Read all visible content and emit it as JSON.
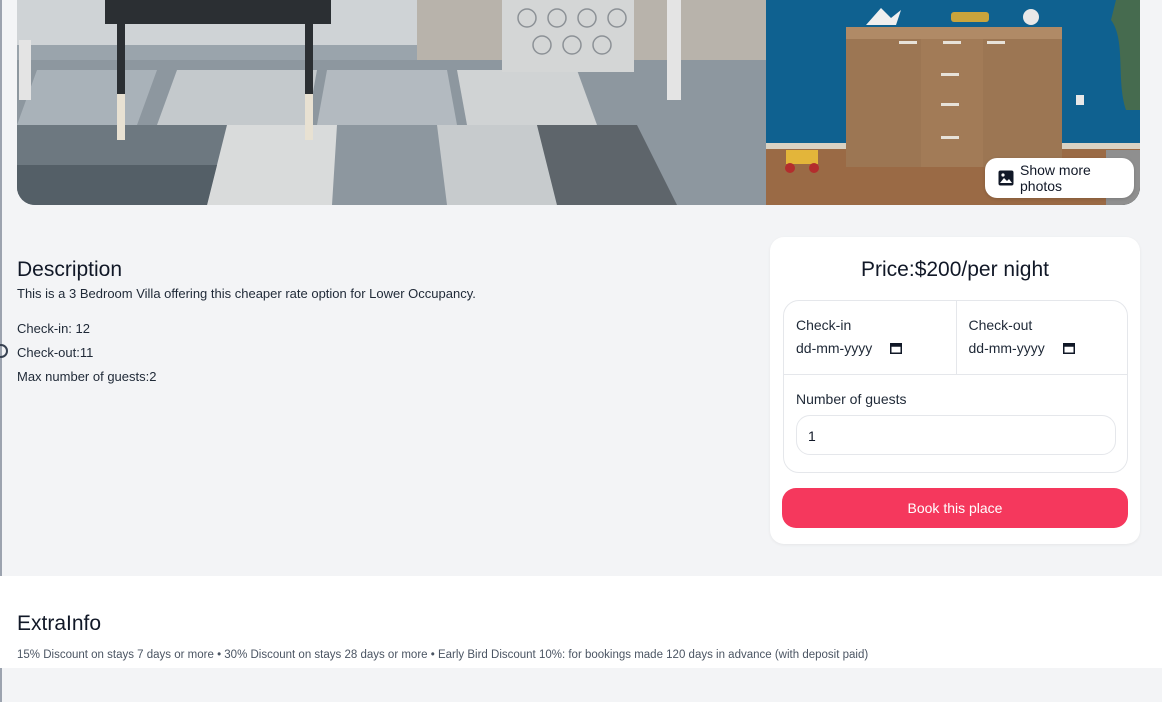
{
  "gallery": {
    "show_more_label": "Show more photos",
    "show_more_icon": "image-icon"
  },
  "description": {
    "heading": "Description",
    "text": "This is a 3 Bedroom Villa offering this cheaper rate option for Lower Occupancy.",
    "check_in": "Check-in: 12",
    "check_out": "Check-out:11",
    "max_guests": "Max number of guests:2"
  },
  "booking": {
    "price": "Price:$200/per night",
    "check_in_label": "Check-in",
    "check_in_value": "dd-mm-yyyy",
    "check_out_label": "Check-out",
    "check_out_value": "dd-mm-yyyy",
    "date_icon": "calendar-icon",
    "guests_label": "Number of guests",
    "guests_value": "1",
    "book_label": "Book this place",
    "accent_color": "#f5385d"
  },
  "extra": {
    "heading": "ExtraInfo",
    "text": "15% Discount on stays 7 days or more • 30% Discount on stays 28 days or more • Early Bird Discount 10%: for bookings made 120 days in advance (with deposit paid)"
  }
}
